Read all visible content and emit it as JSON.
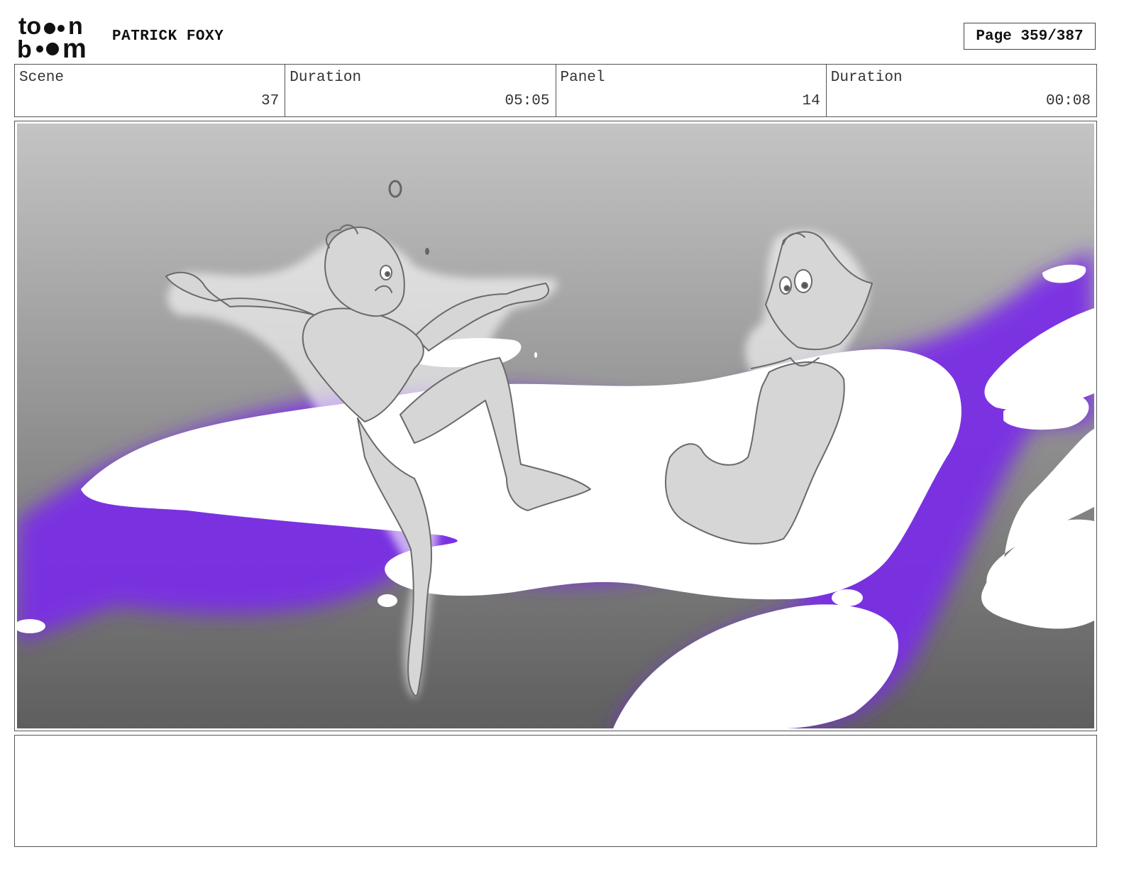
{
  "header": {
    "logo_top": "to",
    "logo_bottom": "b",
    "logo_m": "m",
    "logo_n": "n",
    "project_title": "PATRICK FOXY",
    "page_label": "Page 359/387"
  },
  "info": {
    "scene_label": "Scene",
    "scene_value": "37",
    "scene_duration_label": "Duration",
    "scene_duration_value": "05:05",
    "panel_label": "Panel",
    "panel_value": "14",
    "panel_duration_label": "Duration",
    "panel_duration_value": "00:08"
  },
  "panel": {
    "colors": {
      "sky_top": "#c4c4c4",
      "sky_bottom": "#5e5e5e",
      "glow": "#7a2ee6",
      "cloud": "#ffffff",
      "figure_fill": "#d6d6d6",
      "figure_line": "#6a6a6a"
    }
  },
  "notes": {
    "text": ""
  }
}
